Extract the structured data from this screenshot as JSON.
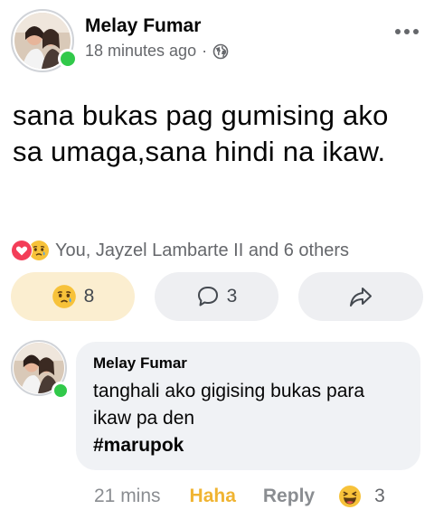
{
  "post": {
    "author": "Melay Fumar",
    "time": "18 minutes ago",
    "separator": "·",
    "privacy_icon": "globe-icon",
    "more_icon": "more-options-icon",
    "text": "sana bukas pag gumising ako sa umaga,sana hindi na ikaw."
  },
  "reactions": {
    "icons": [
      "heart-reaction-icon",
      "sad-reaction-icon"
    ],
    "summary": "You, Jayzel Lambarte II and 6 others"
  },
  "actions": {
    "react": {
      "icon": "sad-reaction-icon",
      "count": "8"
    },
    "comment": {
      "icon": "comment-icon",
      "count": "3"
    },
    "share": {
      "icon": "share-icon"
    }
  },
  "comment": {
    "author": "Melay Fumar",
    "line1": "tanghali ako gigising bukas para",
    "line2": "ikaw pa den",
    "hashtag": "#marupok",
    "time": "21 mins",
    "haha_label": "Haha",
    "reply_label": "Reply",
    "reaction_icon": "haha-reaction-icon",
    "reaction_count": "3"
  },
  "colors": {
    "online": "#31c94a",
    "haha": "#f0b432",
    "react_bg": "#fbeed0",
    "button_bg": "#eeeff2",
    "bubble_bg": "#f0f2f5",
    "secondary_text": "#65676b"
  }
}
